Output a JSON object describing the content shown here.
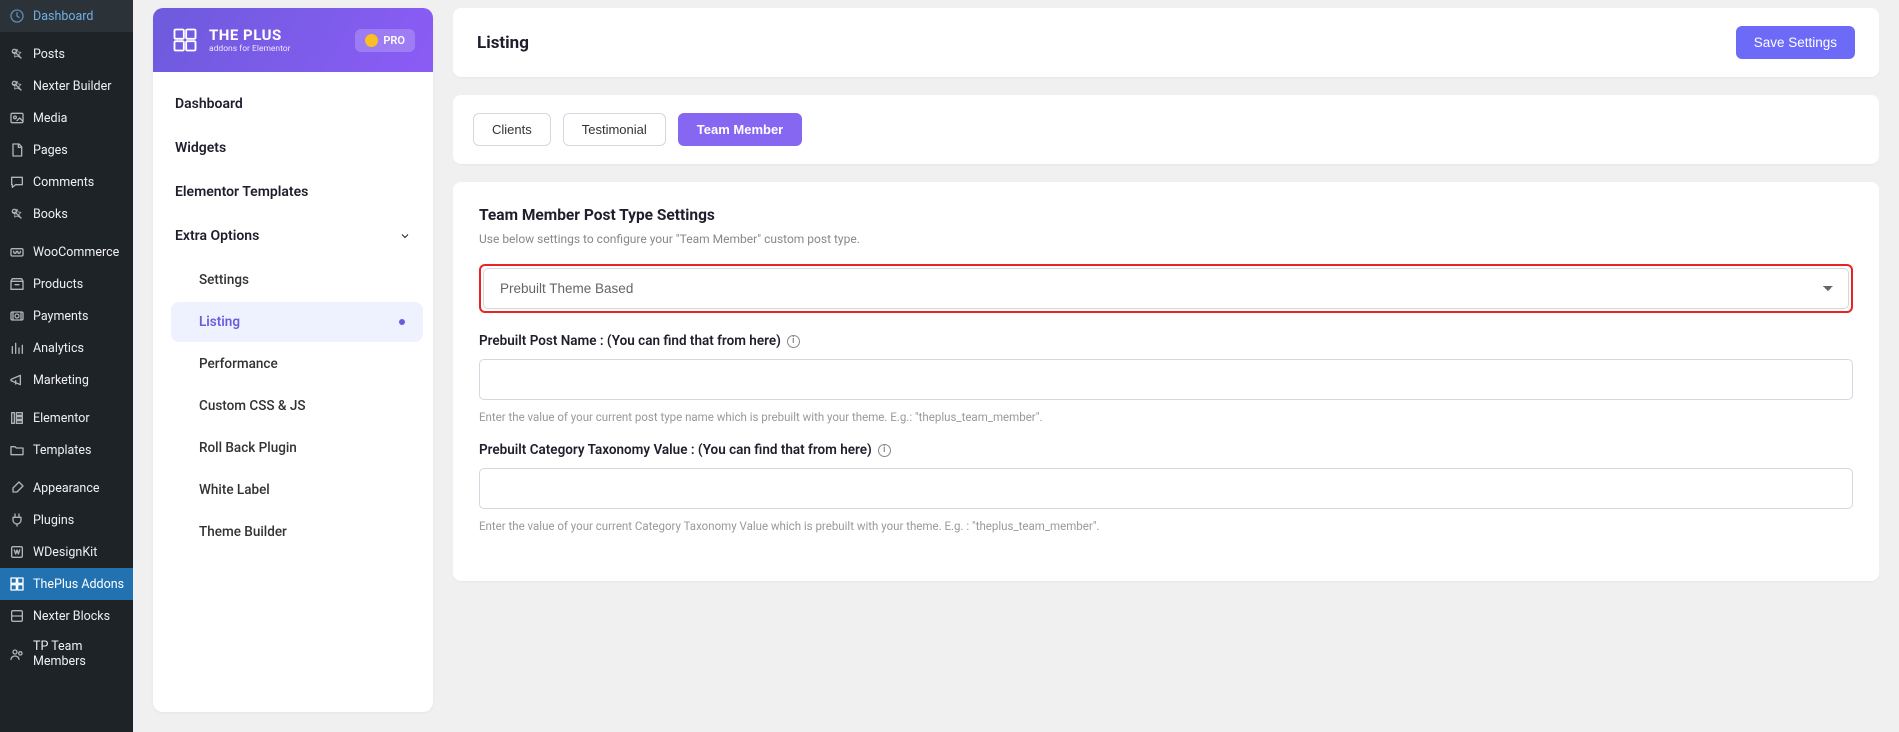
{
  "wp_menu": {
    "items": [
      {
        "label": "Dashboard",
        "icon": "dashboard"
      },
      {
        "label": "Posts",
        "icon": "pin"
      },
      {
        "label": "Nexter Builder",
        "icon": "pin"
      },
      {
        "label": "Media",
        "icon": "media"
      },
      {
        "label": "Pages",
        "icon": "page"
      },
      {
        "label": "Comments",
        "icon": "comment"
      },
      {
        "label": "Books",
        "icon": "pin"
      },
      {
        "label": "WooCommerce",
        "icon": "woo"
      },
      {
        "label": "Products",
        "icon": "archive"
      },
      {
        "label": "Payments",
        "icon": "money"
      },
      {
        "label": "Analytics",
        "icon": "chart"
      },
      {
        "label": "Marketing",
        "icon": "megaphone"
      },
      {
        "label": "Elementor",
        "icon": "elementor"
      },
      {
        "label": "Templates",
        "icon": "folder"
      },
      {
        "label": "Appearance",
        "icon": "brush"
      },
      {
        "label": "Plugins",
        "icon": "plug"
      },
      {
        "label": "WDesignKit",
        "icon": "wd"
      },
      {
        "label": "ThePlus Addons",
        "icon": "plus",
        "active": true
      },
      {
        "label": "Nexter Blocks",
        "icon": "block"
      },
      {
        "label": "TP Team Members",
        "icon": "team"
      }
    ]
  },
  "plugin_panel": {
    "brand_main": "THE PLUS",
    "brand_sub": "addons for Elementor",
    "pro_label": "PRO",
    "nav": [
      {
        "label": "Dashboard"
      },
      {
        "label": "Widgets"
      },
      {
        "label": "Elementor Templates"
      },
      {
        "label": "Extra Options",
        "expandable": true,
        "expanded": true,
        "children": [
          {
            "label": "Settings"
          },
          {
            "label": "Listing",
            "active": true
          },
          {
            "label": "Performance"
          },
          {
            "label": "Custom CSS & JS"
          },
          {
            "label": "Roll Back Plugin"
          },
          {
            "label": "White Label"
          },
          {
            "label": "Theme Builder"
          }
        ]
      }
    ]
  },
  "content": {
    "page_title": "Listing",
    "save_label": "Save Settings",
    "tabs": [
      {
        "label": "Clients"
      },
      {
        "label": "Testimonial"
      },
      {
        "label": "Team Member",
        "active": true
      }
    ],
    "section": {
      "title": "Team Member Post Type Settings",
      "desc": "Use below settings to configure your \"Team Member\" custom post type.",
      "dropdown_value": "Prebuilt Theme Based",
      "field1": {
        "label": "Prebuilt Post Name : (You can find that from here)",
        "value": "",
        "hint": "Enter the value of your current post type name which is prebuilt with your theme. E.g.: \"theplus_team_member\"."
      },
      "field2": {
        "label": "Prebuilt Category Taxonomy Value : (You can find that from here)",
        "value": "",
        "hint": "Enter the value of your current Category Taxonomy Value which is prebuilt with your theme. E.g. : \"theplus_team_member\"."
      }
    }
  }
}
